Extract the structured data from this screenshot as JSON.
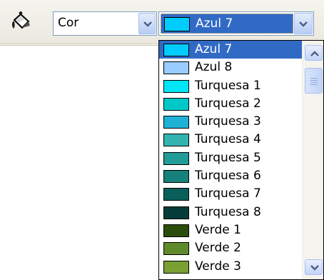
{
  "toolbar": {
    "fill_icon": "paint-bucket-icon",
    "fill_type": {
      "value": "Cor"
    },
    "color": {
      "value": "Azul 7",
      "swatch": "#00ccff"
    }
  },
  "color_list": {
    "items": [
      {
        "label": "Azul 7",
        "color": "#00ccff",
        "selected": true
      },
      {
        "label": "Azul 8",
        "color": "#99ccff"
      },
      {
        "label": "Turquesa 1",
        "color": "#00e5f5"
      },
      {
        "label": "Turquesa 2",
        "color": "#00c8c8"
      },
      {
        "label": "Turquesa 3",
        "color": "#1fb0d8"
      },
      {
        "label": "Turquesa 4",
        "color": "#33b4b0"
      },
      {
        "label": "Turquesa 5",
        "color": "#229c98"
      },
      {
        "label": "Turquesa 6",
        "color": "#17807c"
      },
      {
        "label": "Turquesa 7",
        "color": "#0b5f5a"
      },
      {
        "label": "Turquesa 8",
        "color": "#053c3a"
      },
      {
        "label": "Verde 1",
        "color": "#2b4d0b"
      },
      {
        "label": "Verde 2",
        "color": "#5f8a2c"
      },
      {
        "label": "Verde 3",
        "color": "#7aa034"
      }
    ]
  }
}
